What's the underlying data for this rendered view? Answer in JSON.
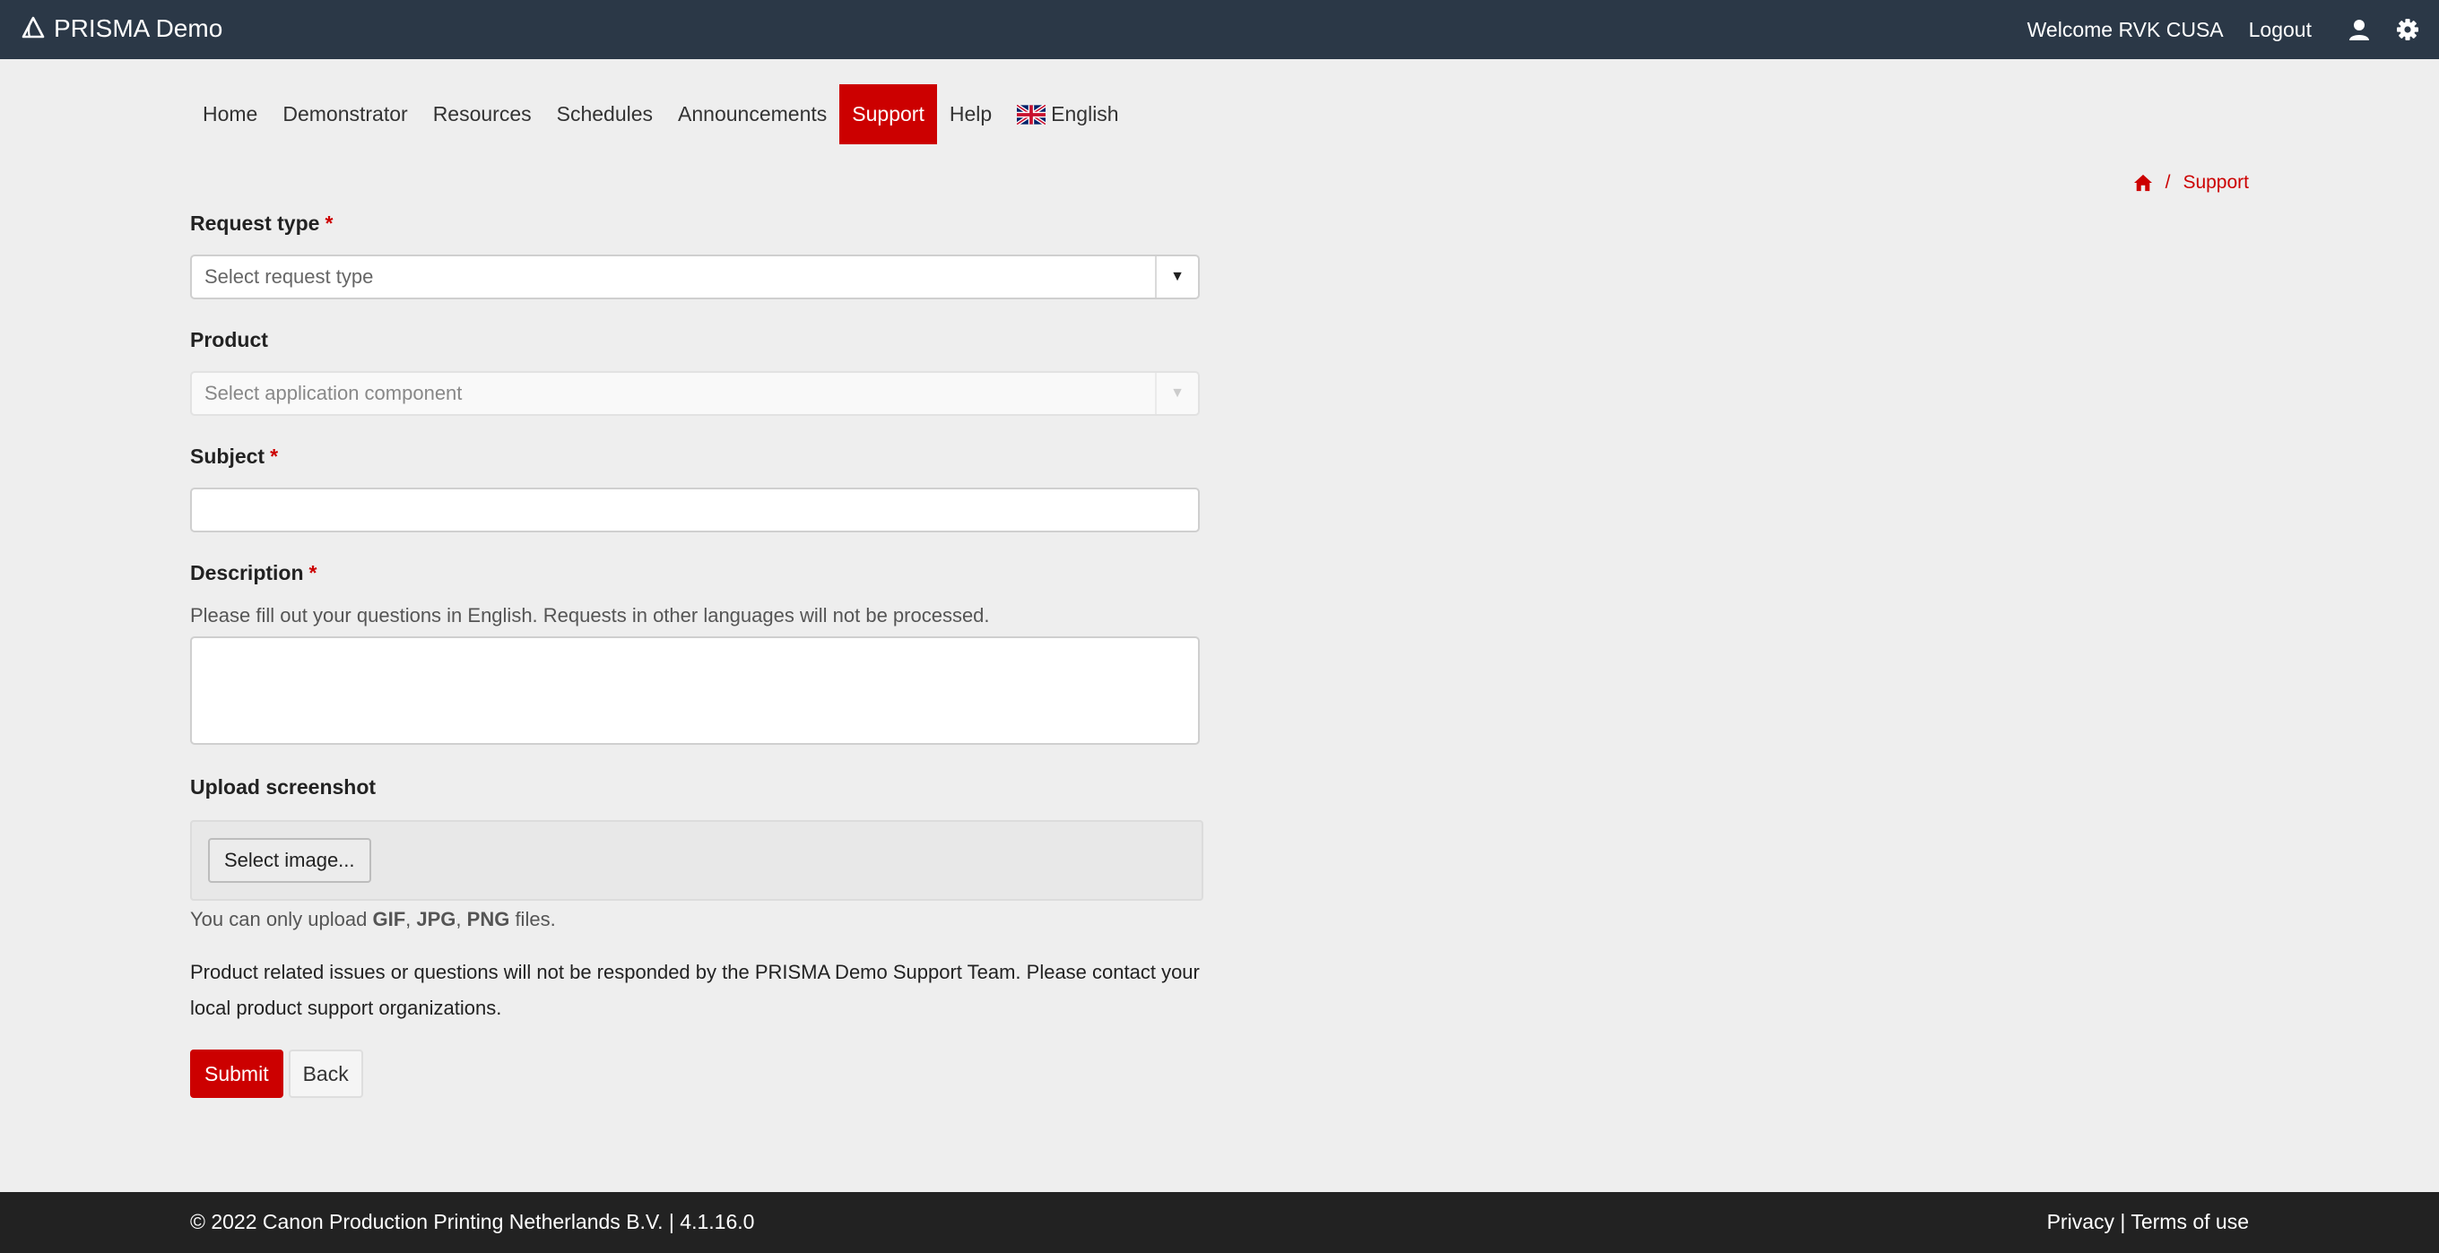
{
  "header": {
    "brand": "PRISMA Demo",
    "welcome": "Welcome RVK CUSA",
    "logout": "Logout",
    "icons": [
      "user-icon",
      "gear-icon"
    ]
  },
  "nav": {
    "items": [
      {
        "label": "Home"
      },
      {
        "label": "Demonstrator"
      },
      {
        "label": "Resources"
      },
      {
        "label": "Schedules"
      },
      {
        "label": "Announcements"
      },
      {
        "label": "Support",
        "active": true
      },
      {
        "label": "Help"
      },
      {
        "label": "English",
        "icon": "uk-flag-icon"
      }
    ]
  },
  "breadcrumb": {
    "home_icon": "home-icon",
    "separator": "/",
    "current": "Support"
  },
  "form": {
    "request_type": {
      "label": "Request type",
      "required": "*",
      "placeholder": "Select request type"
    },
    "product": {
      "label": "Product",
      "placeholder": "Select application component"
    },
    "subject": {
      "label": "Subject",
      "required": "*",
      "value": ""
    },
    "description": {
      "label": "Description",
      "required": "*",
      "help": "Please fill out your questions in English. Requests in other languages will not be processed.",
      "value": ""
    },
    "upload": {
      "label": "Upload screenshot",
      "button": "Select image...",
      "help_prefix": "You can only upload ",
      "gif": "GIF",
      "sep1": ", ",
      "jpg": "JPG",
      "sep2": ", ",
      "png": "PNG",
      "help_suffix": " files."
    },
    "note": "Product related issues or questions will not be responded by the PRISMA Demo Support Team. Please contact your local product support organizations.",
    "submit": "Submit",
    "back": "Back"
  },
  "footer": {
    "copyright": "© 2022 Canon Production Printing Netherlands B.V. | 4.1.16.0",
    "privacy": "Privacy",
    "sep": " | ",
    "terms": "Terms of use"
  },
  "colors": {
    "topbar": "#2b3847",
    "accent": "#cc0000",
    "footer": "#222222",
    "background": "#eeeeee"
  }
}
